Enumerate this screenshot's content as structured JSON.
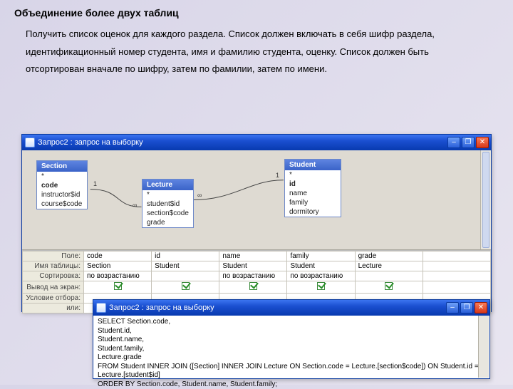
{
  "heading": "Объединение более двух таблиц",
  "paragraph": "Получить список оценок для каждого раздела. Список должен включать в себя шифр раздела, идентификационный номер студента, имя и фамилию студента, оценку. Список должен быть отсортирован вначале по шифру, затем по фамилии, затем по имени.",
  "win1": {
    "title": "Запрос2 : запрос на выборку",
    "tables": {
      "section": {
        "name": "Section",
        "fields": [
          "*",
          "code",
          "instructor$id",
          "course$code"
        ]
      },
      "lecture": {
        "name": "Lecture",
        "fields": [
          "*",
          "student$id",
          "section$code",
          "grade"
        ]
      },
      "student": {
        "name": "Student",
        "fields": [
          "*",
          "id",
          "name",
          "family",
          "dormitory"
        ]
      }
    },
    "join_labels": {
      "one": "1",
      "many": "∞"
    },
    "qbe": {
      "row_headers": [
        "Поле:",
        "Имя таблицы:",
        "Сортировка:",
        "Вывод на экран:",
        "Условие отбора:",
        "или:"
      ],
      "cols": [
        {
          "field": "code",
          "table": "Section",
          "sort": "по возрастанию"
        },
        {
          "field": "id",
          "table": "Student",
          "sort": ""
        },
        {
          "field": "name",
          "table": "Student",
          "sort": "по возрастанию"
        },
        {
          "field": "family",
          "table": "Student",
          "sort": "по возрастанию"
        },
        {
          "field": "grade",
          "table": "Lecture",
          "sort": ""
        }
      ]
    }
  },
  "win2": {
    "title": "Запрос2 : запрос на выборку",
    "sql": [
      "SELECT Section.code,",
      "Student.id,",
      "Student.name,",
      "Student.family,",
      "Lecture.grade",
      "FROM Student INNER JOIN ([Section] INNER JOIN Lecture ON Section.code = Lecture.[section$code]) ON Student.id = Lecture.[student$id]",
      "ORDER BY Section.code, Student.name, Student.family;"
    ]
  },
  "glyphs": {
    "min": "–",
    "max": "❐",
    "close": "✕"
  }
}
